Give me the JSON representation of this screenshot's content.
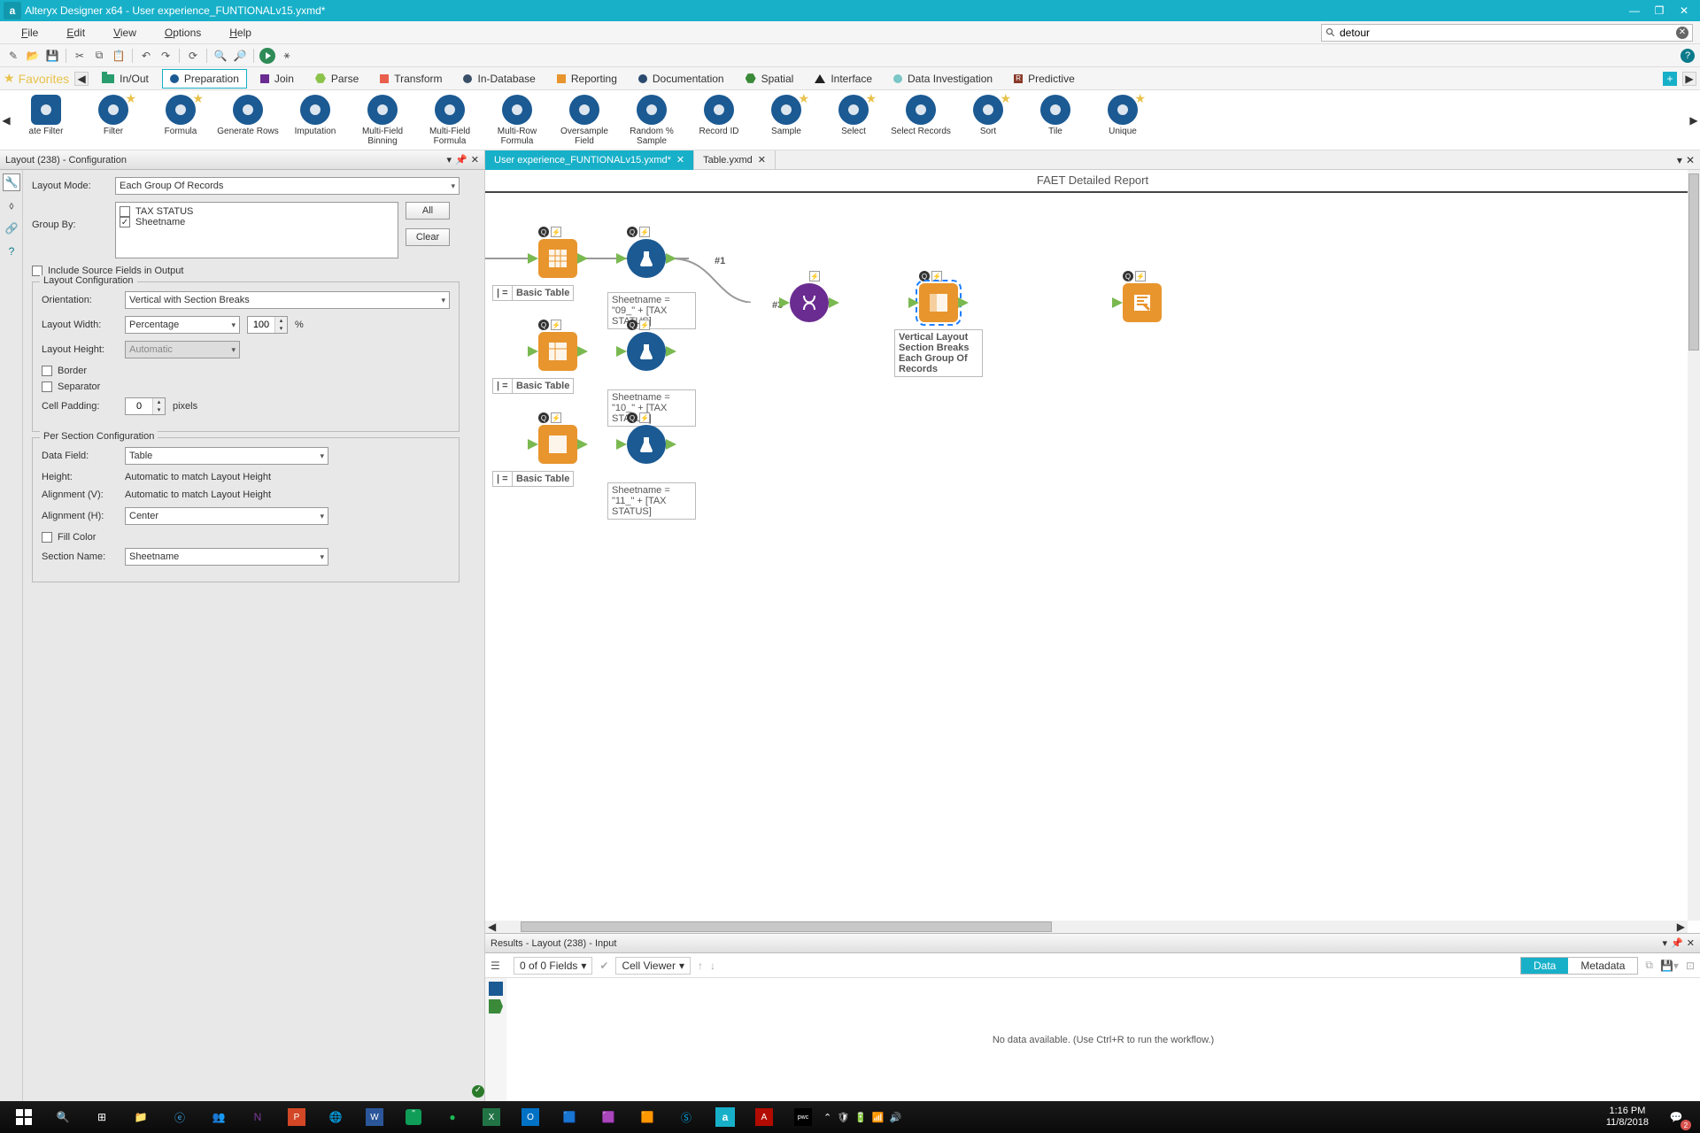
{
  "titlebar": {
    "app": "Alteryx Designer x64",
    "doc": "User experience_FUNTIONALv15.yxmd*"
  },
  "menu": {
    "file": "File",
    "edit": "Edit",
    "view": "View",
    "options": "Options",
    "help": "Help",
    "search": "detour"
  },
  "categories": {
    "favorites": "Favorites",
    "inout": "In/Out",
    "prep": "Preparation",
    "join": "Join",
    "parse": "Parse",
    "transform": "Transform",
    "indb": "In-Database",
    "reporting": "Reporting",
    "doc": "Documentation",
    "spatial": "Spatial",
    "interface": "Interface",
    "datainv": "Data Investigation",
    "predictive": "Predictive"
  },
  "tools": [
    {
      "name": "ate Filter",
      "star": false
    },
    {
      "name": "Filter",
      "star": true
    },
    {
      "name": "Formula",
      "star": true
    },
    {
      "name": "Generate Rows",
      "star": false
    },
    {
      "name": "Imputation",
      "star": false
    },
    {
      "name": "Multi-Field Binning",
      "star": false
    },
    {
      "name": "Multi-Field Formula",
      "star": false
    },
    {
      "name": "Multi-Row Formula",
      "star": false
    },
    {
      "name": "Oversample Field",
      "star": false
    },
    {
      "name": "Random % Sample",
      "star": false
    },
    {
      "name": "Record ID",
      "star": false
    },
    {
      "name": "Sample",
      "star": true
    },
    {
      "name": "Select",
      "star": true
    },
    {
      "name": "Select Records",
      "star": false
    },
    {
      "name": "Sort",
      "star": true
    },
    {
      "name": "Tile",
      "star": false
    },
    {
      "name": "Unique",
      "star": true
    }
  ],
  "config": {
    "title": "Layout (238) - Configuration",
    "layoutMode_label": "Layout Mode:",
    "layoutMode": "Each Group Of Records",
    "groupBy_label": "Group By:",
    "groupFields": [
      {
        "name": "TAX STATUS",
        "checked": false
      },
      {
        "name": "Sheetname",
        "checked": true
      }
    ],
    "btn_all": "All",
    "btn_clear": "Clear",
    "includeSource": "Include Source Fields in Output",
    "layoutConfig": "Layout Configuration",
    "orientation_label": "Orientation:",
    "orientation": "Vertical with Section Breaks",
    "layoutWidth_label": "Layout Width:",
    "layoutWidth": "Percentage",
    "layoutWidthVal": "100",
    "pct": "%",
    "layoutHeight_label": "Layout Height:",
    "layoutHeight": "Automatic",
    "border": "Border",
    "separator": "Separator",
    "cellPadding_label": "Cell Padding:",
    "cellPadding": "0",
    "pixels": "pixels",
    "perSection": "Per Section Configuration",
    "dataField_label": "Data Field:",
    "dataField": "Table",
    "height_label": "Height:",
    "height": "Automatic to match Layout Height",
    "alignV_label": "Alignment (V):",
    "alignV": "Automatic to match Layout Height",
    "alignH_label": "Alignment (H):",
    "alignH": "Center",
    "fillColor": "Fill Color",
    "sectionName_label": "Section Name:",
    "sectionName": "Sheetname"
  },
  "doctabs": {
    "t1": "User experience_FUNTIONALv15.yxmd*",
    "t2": "Table.yxmd"
  },
  "canvas": {
    "title": "FAET Detailed Report",
    "labels": {
      "bt1": "Basic Table",
      "bt2": "Basic Table",
      "bt3": "Basic Table",
      "eq1": "| =",
      "eq2": "| =",
      "eq3": "| =",
      "sn1": "Sheetname = \"09_\" + [TAX STATUS]",
      "sn2": "Sheetname = \"10_\" + [TAX STATUS]",
      "sn3": "Sheetname = \"11_\" + [TAX STATUS]",
      "n1": "#1",
      "n3": "#3",
      "layout": "Vertical Layout\nSection Breaks\nEach Group Of\nRecords"
    }
  },
  "results": {
    "title": "Results - Layout (238) - Input",
    "fields": "0 of 0 Fields",
    "cellviewer": "Cell Viewer",
    "data": "Data",
    "metadata": "Metadata",
    "msg": "No data available. (Use Ctrl+R to run the workflow.)"
  },
  "taskbar": {
    "time": "1:16 PM",
    "date": "11/8/2018",
    "notif": "2"
  }
}
